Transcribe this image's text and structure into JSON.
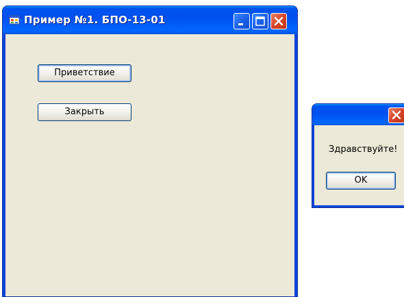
{
  "main_window": {
    "title": "Пример №1. БПО-13-01",
    "icon": "app-form-icon",
    "caption_buttons": [
      "minimize-icon",
      "maximize-icon",
      "close-icon"
    ],
    "buttons": {
      "greet_label": "Приветствие",
      "close_label": "Закрыть"
    }
  },
  "message_box": {
    "title": "",
    "message": "Здравствуйте!",
    "ok_label": "OK",
    "caption_buttons": [
      "close-icon"
    ]
  },
  "colors": {
    "titlebar_blue": "#0054e3",
    "client_background": "#ece9d8",
    "close_button_red": "#d6452a",
    "button_border": "#003c74"
  }
}
